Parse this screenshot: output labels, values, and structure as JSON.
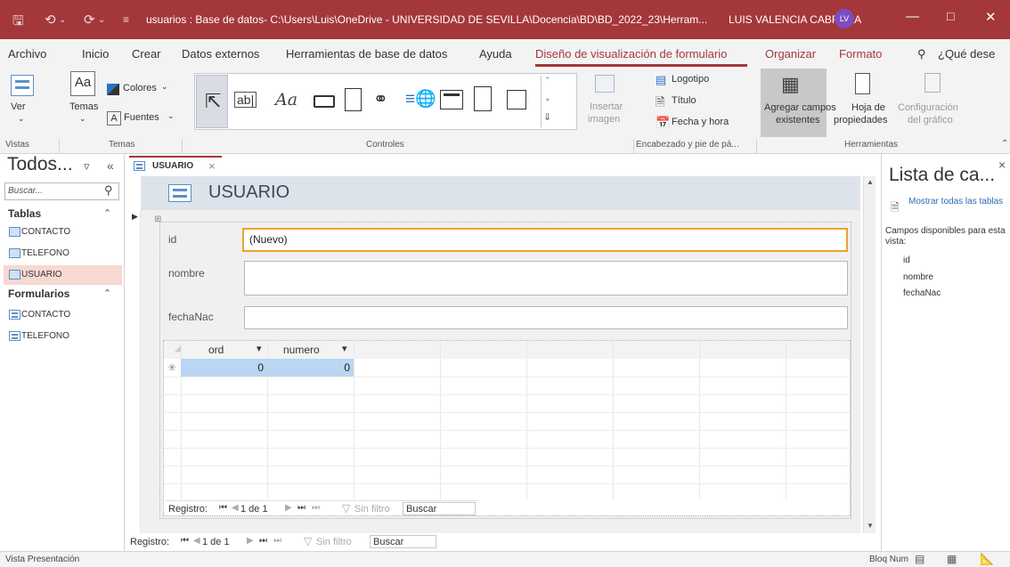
{
  "window": {
    "title": "usuarios : Base de datos- C:\\Users\\Luis\\OneDrive - UNIVERSIDAD DE SEVILLA\\Docencia\\BD\\BD_2022_23\\Herram...",
    "user": "LUIS VALENCIA CABRERA",
    "avatar": "LV"
  },
  "menu": {
    "archivo": "Archivo",
    "inicio": "Inicio",
    "crear": "Crear",
    "datos_externos": "Datos externos",
    "herramientas": "Herramientas de base de datos",
    "ayuda": "Ayuda",
    "diseno": "Diseño de visualización de formulario",
    "organizar": "Organizar",
    "formato": "Formato",
    "search": "¿Qué dese"
  },
  "ribbon": {
    "ver": "Ver",
    "temas": "Temas",
    "colores": "Colores",
    "fuentes": "Fuentes",
    "textbox": "ab|",
    "label": "Aa",
    "insertar_imagen_1": "Insertar",
    "insertar_imagen_2": "imagen",
    "logotipo": "Logotipo",
    "titulo": "Título",
    "fecha_hora": "Fecha y hora",
    "agregar_1": "Agregar campos",
    "agregar_2": "existentes",
    "hoja_1": "Hoja de",
    "hoja_2": "propiedades",
    "config_1": "Configuración",
    "config_2": "del gráfico",
    "groups": {
      "vistas": "Vistas",
      "temas": "Temas",
      "controles": "Controles",
      "encabezado": "Encabezado y pie de pá...",
      "herramientas": "Herramientas"
    }
  },
  "nav": {
    "title": "Todos...",
    "search_placeholder": "Buscar...",
    "tablas": "Tablas",
    "formularios": "Formularios",
    "tables": [
      "CONTACTO",
      "TELEFONO",
      "USUARIO"
    ],
    "forms": [
      "CONTACTO",
      "TELEFONO"
    ]
  },
  "doc": {
    "tab": "USUARIO",
    "header_title": "USUARIO",
    "fields": {
      "id_label": "id",
      "id_value": "(Nuevo)",
      "nombre_label": "nombre",
      "nombre_value": "",
      "fecha_label": "fechaNac",
      "fecha_value": ""
    },
    "subform": {
      "columns": [
        "ord",
        "numero"
      ],
      "new_row_marker": "✳",
      "row": [
        "0",
        "0"
      ],
      "record_label": "Registro:",
      "record_pos": "1 de 1",
      "filter": "Sin filtro",
      "search": "Buscar"
    },
    "record_label": "Registro:",
    "record_pos": "1 de 1",
    "filter": "Sin filtro",
    "search": "Buscar"
  },
  "field_list": {
    "title": "Lista de ca...",
    "show_all": "Mostrar todas las tablas",
    "available": "Campos disponibles para esta vista:",
    "fields": [
      "id",
      "nombre",
      "fechaNac"
    ]
  },
  "status": {
    "left": "Vista Presentación",
    "bloq": "Bloq Num"
  },
  "colors": {
    "accent": "#a4373a",
    "form_header": "#dde3eb",
    "selected_cell": "#b9d6f2",
    "focus_border": "#f0a030"
  }
}
